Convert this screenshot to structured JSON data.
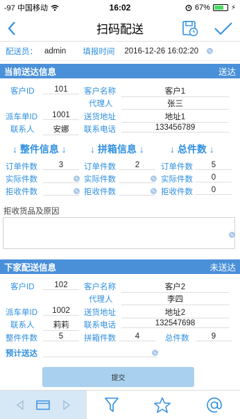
{
  "status_bar": {
    "signal": "-97 中国移动",
    "time": "16:02",
    "battery": "67%",
    "battery_level": 0.67
  },
  "nav": {
    "title": "扫码配送"
  },
  "header_info": {
    "courier_label": "配送员：",
    "courier_value": "admin",
    "time_label": "填报时间",
    "time_value": "2016-12-26 16:02:20"
  },
  "current": {
    "title": "当前送达信息",
    "status": "送达",
    "customer_id_label": "客户ID",
    "customer_id": "101",
    "customer_name_label": "客户名称",
    "customer_name": "客户1",
    "agent_label": "代理人",
    "agent": "张三",
    "dispatch_no_label": "派车单ID",
    "dispatch_no": "1001",
    "address_label": "送货地址",
    "address": "地址1",
    "contact_label": "联系人",
    "contact": "安娜",
    "phone_label": "联系电话",
    "phone": "133456789",
    "groups": [
      {
        "title": "整件信息",
        "ordered_label": "订单件数",
        "ordered": "3",
        "actual_label": "实际件数",
        "rejected_label": "拒收件数"
      },
      {
        "title": "拼箱信息",
        "ordered_label": "订单件数",
        "ordered": "2",
        "actual_label": "实际件数",
        "rejected_label": "拒收件数"
      },
      {
        "title": "总件数",
        "ordered_label": "订单件数",
        "ordered": "5",
        "actual_label": "实际件数",
        "actual": "0",
        "rejected_label": "拒收件数",
        "rejected": "0"
      }
    ],
    "reject_reason_label": "拒收货品及原因"
  },
  "next": {
    "title": "下家配送信息",
    "status": "未送达",
    "customer_id_label": "客户ID",
    "customer_id": "102",
    "customer_name_label": "客户名称",
    "customer_name": "客户2",
    "agent_label": "代理人",
    "agent": "李四",
    "dispatch_no_label": "派车单ID",
    "dispatch_no": "1002",
    "address_label": "送货地址",
    "address": "地址2",
    "contact_label": "联系人",
    "contact": "莉莉",
    "phone_label": "联系电话",
    "phone": "132547698",
    "whole_label": "整件件数",
    "whole": "5",
    "box_label": "拼箱件数",
    "box": "4",
    "total_label": "总件数",
    "total": "9",
    "eta_label": "预计送达"
  },
  "submit_label": "提交",
  "toolbar": {
    "icons": [
      "back-arrow-icon",
      "tab-window-icon",
      "forward-arrow-icon",
      "filter-icon",
      "star-icon",
      "at-icon"
    ]
  },
  "colors": {
    "accent": "#2f8fe0",
    "section_bg": "#4a90d9",
    "submit_bg": "#a9d0ee",
    "toolbar_seg_bg": "#d6e7f6"
  }
}
